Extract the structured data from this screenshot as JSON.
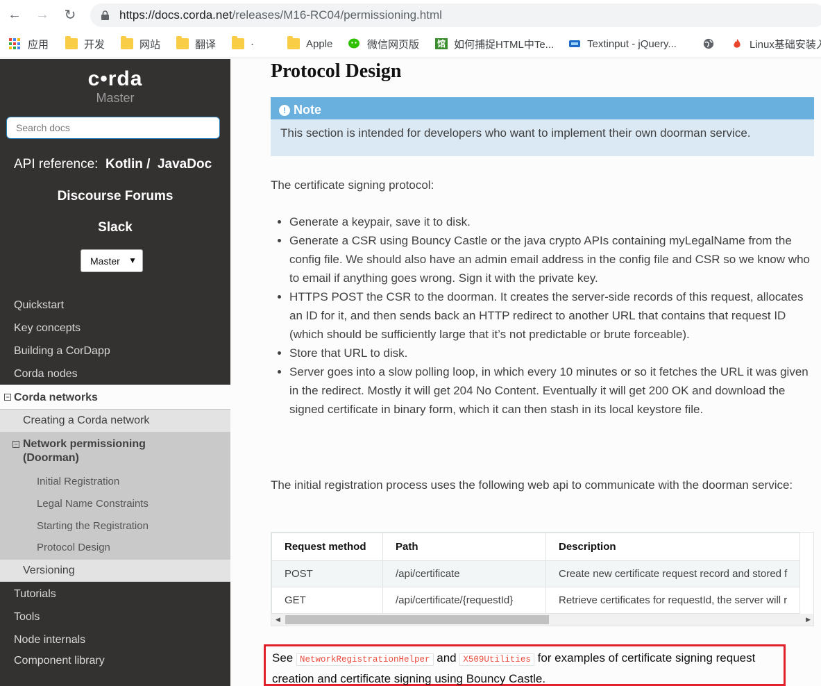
{
  "browser": {
    "url_host": "https://docs.corda.net",
    "url_path": "/releases/M16-RC04/permissioning.html",
    "bookmarks": [
      "应用",
      "开发",
      "网站",
      "翻译",
      "·",
      "Apple",
      "微信网页版",
      "如何捕捉HTML中Te...",
      "Textinput - jQuery...",
      "",
      "Linux基础安装入"
    ]
  },
  "sidebar": {
    "logo": "c•rda",
    "version_label": "Master",
    "search_placeholder": "Search docs",
    "api_ref_label": "API reference:",
    "api_kotlin": "Kotlin",
    "api_sep": "/",
    "api_javadoc": "JavaDoc",
    "discourse": "Discourse Forums",
    "slack": "Slack",
    "version_select": "Master",
    "menu_top": [
      "Quickstart",
      "Key concepts",
      "Building a CorDapp",
      "Corda nodes"
    ],
    "current_section": "Corda networks",
    "sub_creating": "Creating a Corda network",
    "sub_permissioning": "Network permissioning (Doorman)",
    "sub_permissioning_l1": "Network permissioning",
    "sub_permissioning_l2": "(Doorman)",
    "sub_items": [
      "Initial Registration",
      "Legal Name Constraints",
      "Starting the Registration",
      "Protocol Design"
    ],
    "sub_versioning": "Versioning",
    "menu_bottom": [
      "Tutorials",
      "Tools",
      "Node internals",
      "Component library"
    ]
  },
  "content": {
    "title": "Protocol Design",
    "note_title": "Note",
    "note_body": "This section is intended for developers who want to implement their own doorman service.",
    "intro": "The certificate signing protocol:",
    "steps": [
      "Generate a keypair, save it to disk.",
      "Generate a CSR using Bouncy Castle or the java crypto APIs containing myLegalName from the config file. We should also have an admin email address in the config file and CSR so we know who to email if anything goes wrong. Sign it with the private key.",
      "HTTPS POST the CSR to the doorman. It creates the server-side records of this request, allocates an ID for it, and then sends back an HTTP redirect to another URL that contains that request ID (which should be sufficiently large that it’s not predictable or brute forceable).",
      "Store that URL to disk.",
      "Server goes into a slow polling loop, in which every 10 minutes or so it fetches the URL it was given in the redirect. Mostly it will get 204 No Content. Eventually it will get 200 OK and download the signed certificate in binary form, which it can then stash in its local keystore file."
    ],
    "registration_text": "The initial registration process uses the following web api to communicate with the doorman service:",
    "table": {
      "headers": [
        "Request method",
        "Path",
        "Description"
      ],
      "rows": [
        [
          "POST",
          "/api/certificate",
          "Create new certificate request record and stored f"
        ],
        [
          "GET",
          "/api/certificate/{requestId}",
          "Retrieve certificates for requestId, the server will r"
        ]
      ]
    },
    "see_prefix": "See",
    "code1": "NetworkRegistrationHelper",
    "and": "and",
    "code2": "X509Utilities",
    "see_suffix": "for examples of certificate signing request creation and certificate signing using Bouncy Castle."
  }
}
